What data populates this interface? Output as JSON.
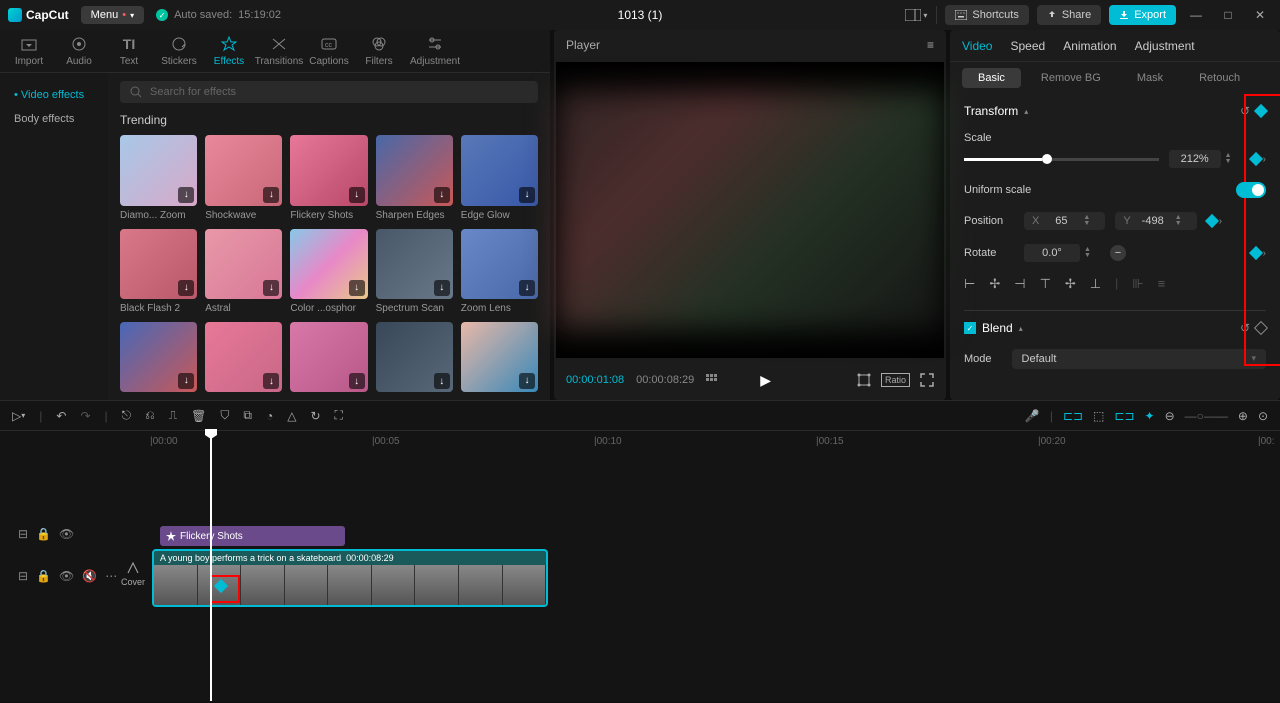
{
  "app": {
    "name": "CapCut",
    "menu": "Menu",
    "autosave_prefix": "Auto saved:",
    "autosave_time": "15:19:02",
    "project_title": "1013 (1)"
  },
  "titlebar": {
    "shortcuts": "Shortcuts",
    "share": "Share",
    "export": "Export"
  },
  "top_tabs": [
    {
      "label": "Import",
      "icon": "import"
    },
    {
      "label": "Audio",
      "icon": "audio"
    },
    {
      "label": "Text",
      "icon": "text"
    },
    {
      "label": "Stickers",
      "icon": "stickers"
    },
    {
      "label": "Effects",
      "icon": "effects",
      "active": true
    },
    {
      "label": "Transitions",
      "icon": "transitions"
    },
    {
      "label": "Captions",
      "icon": "captions"
    },
    {
      "label": "Filters",
      "icon": "filters"
    },
    {
      "label": "Adjustment",
      "icon": "adjustment"
    }
  ],
  "sidebar": {
    "items": [
      "Video effects",
      "Body effects"
    ],
    "active_index": 0
  },
  "search": {
    "placeholder": "Search for effects"
  },
  "section": {
    "title": "Trending"
  },
  "effects": [
    {
      "label": "Diamo... Zoom",
      "bg": "linear-gradient(135deg,#a8c8e8,#d8a8c8)"
    },
    {
      "label": "Shockwave",
      "bg": "linear-gradient(135deg,#e8889a,#c86878)"
    },
    {
      "label": "Flickery Shots",
      "bg": "linear-gradient(135deg,#e8789a,#b84868)"
    },
    {
      "label": "Sharpen Edges",
      "bg": "linear-gradient(135deg,#4868a8,#c85858)"
    },
    {
      "label": "Edge Glow",
      "bg": "linear-gradient(135deg,#5878b8,#3858a8)"
    },
    {
      "label": "Black Flash 2",
      "bg": "linear-gradient(135deg,#d87888,#b85868)"
    },
    {
      "label": "Astral",
      "bg": "linear-gradient(135deg,#e898a8,#d87898)"
    },
    {
      "label": "Color ...osphor",
      "bg": "linear-gradient(135deg,#88c8e8,#e888c8,#e8c888)"
    },
    {
      "label": "Spectrum Scan",
      "bg": "linear-gradient(135deg,#485868,#687888)"
    },
    {
      "label": "Zoom Lens",
      "bg": "linear-gradient(135deg,#6888c8,#4868a8)"
    },
    {
      "label": "",
      "bg": "linear-gradient(135deg,#4868b8,#c85858)"
    },
    {
      "label": "",
      "bg": "linear-gradient(135deg,#e87898,#c86888)"
    },
    {
      "label": "",
      "bg": "linear-gradient(135deg,#d878a8,#b85888)"
    },
    {
      "label": "",
      "bg": "linear-gradient(135deg,#384858,#586878)"
    },
    {
      "label": "",
      "bg": "linear-gradient(135deg,#e8b8a8,#3888b8)"
    }
  ],
  "player": {
    "title": "Player",
    "time_current": "00:00:01:08",
    "time_total": "00:00:08:29"
  },
  "right_tabs": [
    {
      "label": "Video",
      "active": true
    },
    {
      "label": "Speed"
    },
    {
      "label": "Animation"
    },
    {
      "label": "Adjustment"
    }
  ],
  "sub_tabs": [
    {
      "label": "Basic",
      "active": true
    },
    {
      "label": "Remove BG"
    },
    {
      "label": "Mask"
    },
    {
      "label": "Retouch"
    }
  ],
  "props": {
    "transform_title": "Transform",
    "scale_label": "Scale",
    "scale_value": "212%",
    "uniform_label": "Uniform scale",
    "position_label": "Position",
    "pos_x_label": "X",
    "pos_x_value": "65",
    "pos_y_label": "Y",
    "pos_y_value": "-498",
    "rotate_label": "Rotate",
    "rotate_value": "0.0°",
    "blend_title": "Blend",
    "mode_label": "Mode",
    "mode_value": "Default"
  },
  "timeline": {
    "marks": [
      "|00:00",
      "|00:05",
      "|00:10",
      "|00:15",
      "|00:20",
      "|00:"
    ],
    "effect_clip": "Flickery Shots",
    "clip_text": "A young boy performs a trick on a skateboard",
    "clip_time": "00:00:08:29",
    "cover": "Cover"
  }
}
